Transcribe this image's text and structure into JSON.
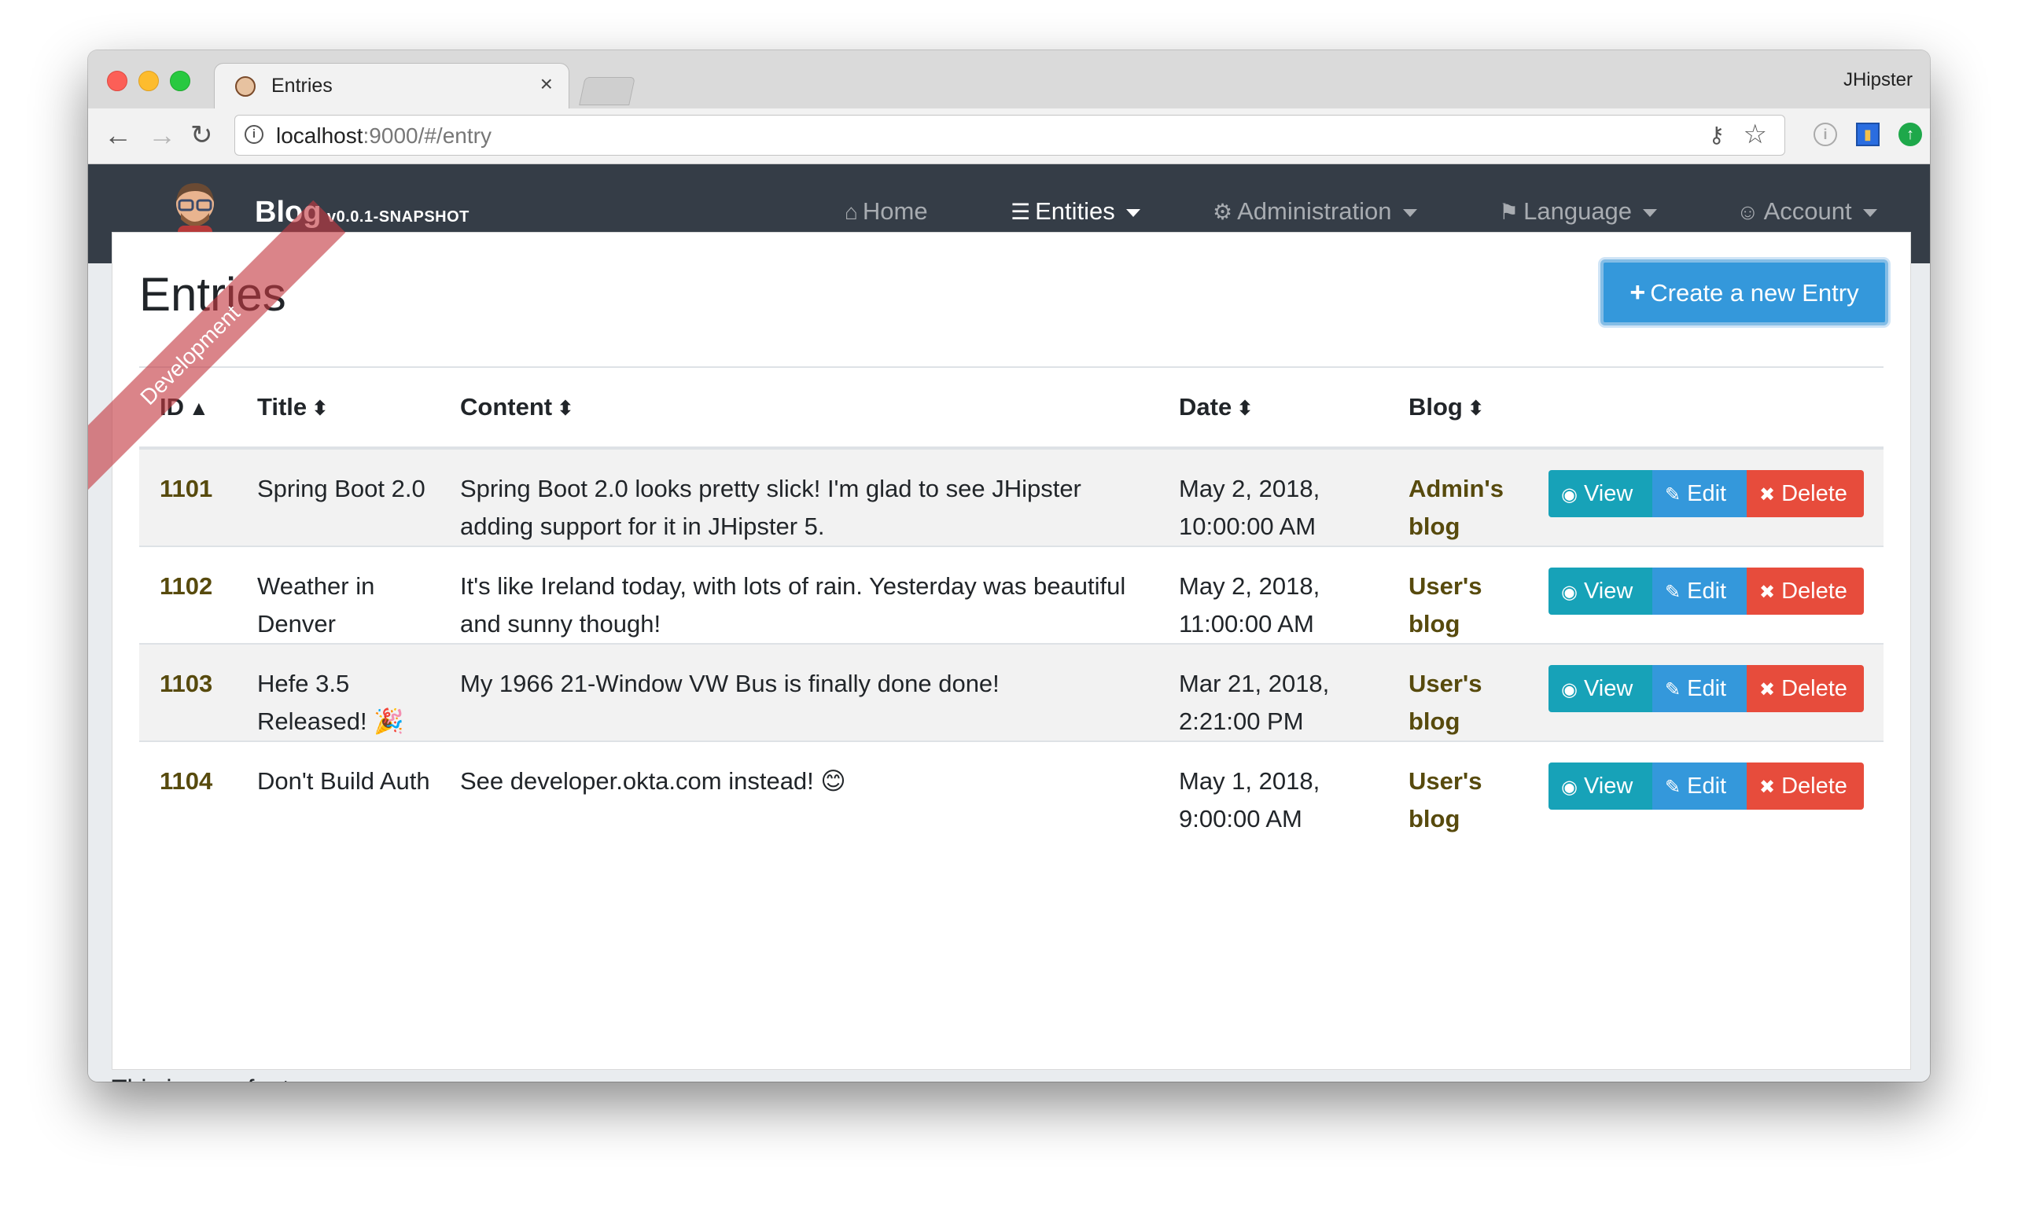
{
  "browser": {
    "tab_title": "Entries",
    "tab_close": "×",
    "profile_name": "JHipster",
    "url_host": "localhost",
    "url_rest": ":9000/#/entry",
    "back_icon": "←",
    "forward_icon": "→",
    "reload_icon": "↻",
    "key_icon": "⚷",
    "star_icon": "☆"
  },
  "navbar": {
    "brand": "Blog",
    "version": "v0.0.1-SNAPSHOT",
    "ribbon": "Development",
    "items": [
      {
        "icon": "⌂",
        "label": "Home",
        "active": false
      },
      {
        "icon": "☰",
        "label": "Entities",
        "active": true
      },
      {
        "icon": "⚙",
        "label": "Administration",
        "active": false
      },
      {
        "icon": "⚑",
        "label": "Language",
        "active": false
      },
      {
        "icon": "☺",
        "label": "Account",
        "active": false
      }
    ]
  },
  "main": {
    "title": "Entries",
    "create_button": "Create a new Entry",
    "columns": [
      "ID",
      "Title",
      "Content",
      "Date",
      "Blog"
    ],
    "rows": [
      {
        "id": "1101",
        "title": "Spring Boot 2.0",
        "content": "Spring Boot 2.0 looks pretty slick! I'm glad to see JHipster adding support for it in JHipster 5.",
        "date": "May 2, 2018, 10:00:00 AM",
        "blog": "Admin's blog"
      },
      {
        "id": "1102",
        "title": "Weather in Denver",
        "content": "It's like Ireland today, with lots of rain. Yesterday was beautiful and sunny though!",
        "date": "May 2, 2018, 11:00:00 AM",
        "blog": "User's blog"
      },
      {
        "id": "1103",
        "title": "Hefe 3.5 Released! 🎉",
        "content": "My 1966 21-Window VW Bus is finally done done!",
        "date": "Mar 21, 2018, 2:21:00 PM",
        "blog": "User's blog"
      },
      {
        "id": "1104",
        "title": "Don't Build Auth",
        "content": "See developer.okta.com instead! 😊",
        "date": "May 1, 2018, 9:00:00 AM",
        "blog": "User's blog"
      }
    ],
    "actions": {
      "view": "View",
      "edit": "Edit",
      "delete": "Delete"
    }
  },
  "footer": "This is your footer",
  "colors": {
    "navbar": "#353d47",
    "primary": "#3498db",
    "info": "#17a2b8",
    "danger": "#e74c3c",
    "ribbon": "#c43840"
  }
}
